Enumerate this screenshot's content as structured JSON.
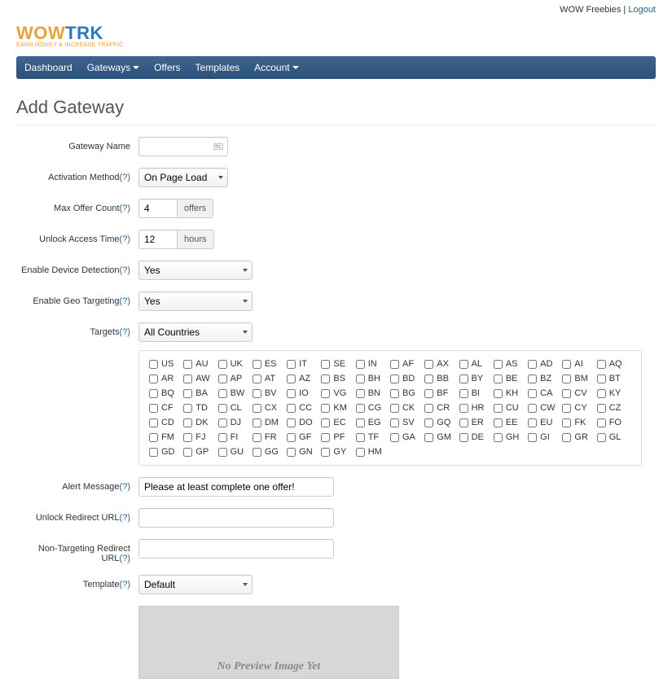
{
  "topbar": {
    "freebies": "WOW Freebies",
    "separator": " | ",
    "logout": "Logout"
  },
  "logo": {
    "part1": "WOW",
    "part2": "TRK",
    "sub": "EARN MONEY & INCREASE TRAFFIC"
  },
  "nav": {
    "dashboard": "Dashboard",
    "gateways": "Gateways",
    "offers": "Offers",
    "templates": "Templates",
    "account": "Account"
  },
  "page_title": "Add Gateway",
  "labels": {
    "gateway_name": "Gateway Name",
    "activation_method": "Activation Method",
    "max_offer_count": "Max Offer Count",
    "unlock_access_time": "Unlock Access Time",
    "enable_device_detection": "Enable Device Detection",
    "enable_geo_targeting": "Enable Geo Targeting",
    "targets": "Targets",
    "alert_message": "Alert Message",
    "unlock_redirect_url": "Unlock Redirect URL",
    "non_targeting_redirect_url": "Non-Targeting Redirect URL",
    "template": "Template"
  },
  "help_marker": "(?)",
  "values": {
    "gateway_name": "",
    "activation_method": "On Page Load",
    "max_offer_count": "4",
    "max_offer_addon": "offers",
    "unlock_access_time": "12",
    "unlock_access_addon": "hours",
    "enable_device_detection": "Yes",
    "enable_geo_targeting": "Yes",
    "targets": "All Countries",
    "alert_message": "Please at least complete one offer!",
    "unlock_redirect_url": "",
    "non_targeting_redirect_url": "",
    "template": "Default"
  },
  "preview": "No Preview Image Yet",
  "countries": [
    [
      "US",
      "AU",
      "UK",
      "ES",
      "IT",
      "SE",
      "IN",
      "AF",
      "AX",
      "AL",
      "AS",
      "AD",
      "AI",
      "AQ"
    ],
    [
      "AR",
      "AW",
      "AP",
      "AT",
      "AZ",
      "BS",
      "BH",
      "BD",
      "BB",
      "BY",
      "BE",
      "BZ",
      "BM",
      "BT"
    ],
    [
      "BQ",
      "BA",
      "BW",
      "BV",
      "IO",
      "VG",
      "BN",
      "BG",
      "BF",
      "BI",
      "KH",
      "CA",
      "CV",
      "KY"
    ],
    [
      "CF",
      "TD",
      "CL",
      "CX",
      "CC",
      "KM",
      "CG",
      "CK",
      "CR",
      "HR",
      "CU",
      "CW",
      "CY",
      "CZ"
    ],
    [
      "CD",
      "DK",
      "DJ",
      "DM",
      "DO",
      "EC",
      "EG",
      "SV",
      "GQ",
      "ER",
      "EE",
      "EU",
      "FK",
      "FO"
    ],
    [
      "FM",
      "FJ",
      "FI",
      "FR",
      "GF",
      "PF",
      "TF",
      "GA",
      "GM",
      "DE",
      "GH",
      "GI",
      "GR",
      "GL"
    ],
    [
      "GD",
      "GP",
      "GU",
      "GG",
      "GN",
      "GY",
      "HM",
      "",
      "",
      "",
      "",
      "",
      "",
      ""
    ]
  ]
}
